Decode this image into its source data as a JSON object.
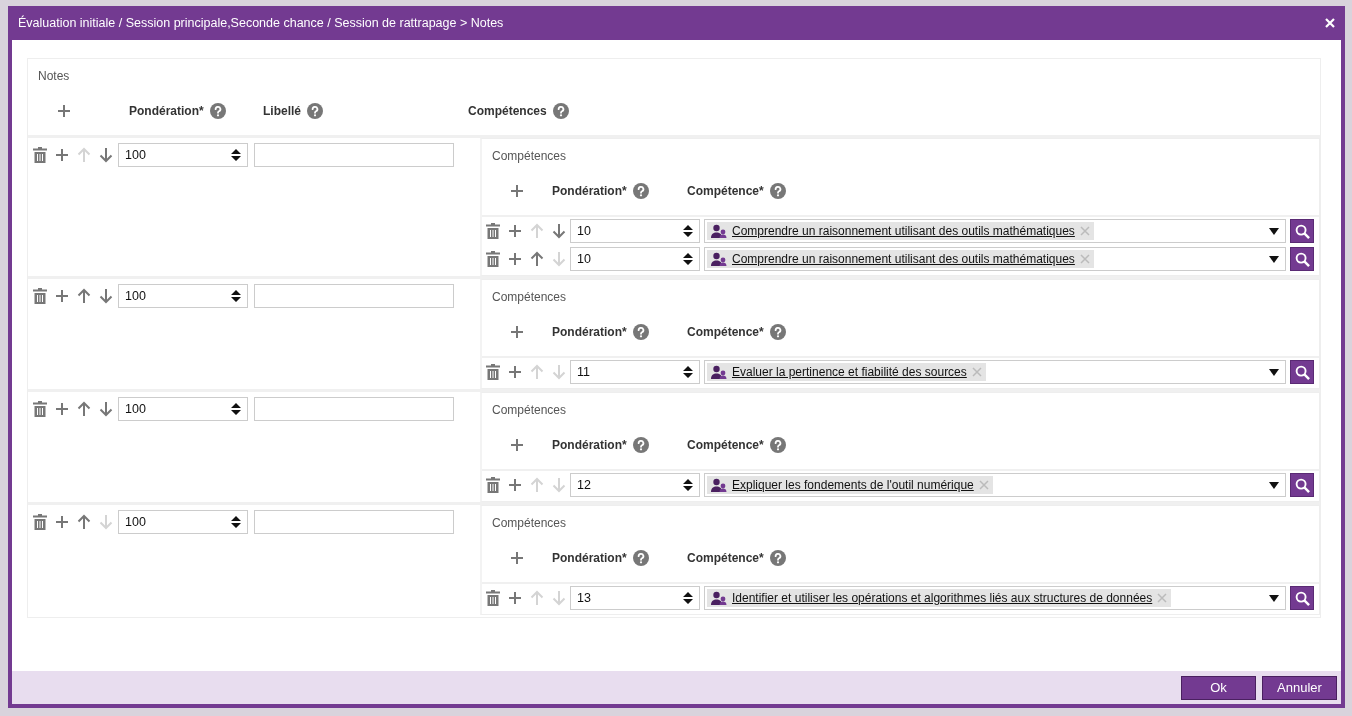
{
  "dialog": {
    "title": "Évaluation initiale / Session principale,Seconde chance / Session de rattrapage > Notes"
  },
  "notes": {
    "section_label": "Notes",
    "columns": [
      "Pondération*",
      "Libellé",
      "Compétences"
    ],
    "rows": [
      {
        "weight": "100",
        "label": "",
        "up_disabled": true,
        "down_disabled": false,
        "competences": {
          "section_label": "Compétences",
          "columns": [
            "Pondération*",
            "Compétence*"
          ],
          "rows": [
            {
              "weight": "10",
              "competence": "Comprendre un raisonnement utilisant des outils mathématiques",
              "up_disabled": true,
              "down_disabled": false
            },
            {
              "weight": "10",
              "competence": "Comprendre un raisonnement utilisant des outils mathématiques",
              "up_disabled": false,
              "down_disabled": true
            }
          ]
        }
      },
      {
        "weight": "100",
        "label": "",
        "up_disabled": false,
        "down_disabled": false,
        "competences": {
          "section_label": "Compétences",
          "columns": [
            "Pondération*",
            "Compétence*"
          ],
          "rows": [
            {
              "weight": "11",
              "competence": "Evaluer la pertinence et fiabilité des sources",
              "up_disabled": true,
              "down_disabled": true
            }
          ]
        }
      },
      {
        "weight": "100",
        "label": "",
        "up_disabled": false,
        "down_disabled": false,
        "competences": {
          "section_label": "Compétences",
          "columns": [
            "Pondération*",
            "Compétence*"
          ],
          "rows": [
            {
              "weight": "12",
              "competence": "Expliquer les fondements de l'outil numérique",
              "up_disabled": true,
              "down_disabled": true
            }
          ]
        }
      },
      {
        "weight": "100",
        "label": "",
        "up_disabled": false,
        "down_disabled": true,
        "competences": {
          "section_label": "Compétences",
          "columns": [
            "Pondération*",
            "Compétence*"
          ],
          "rows": [
            {
              "weight": "13",
              "competence": "Identifier et utiliser les opérations et algorithmes liés aux structures de données",
              "up_disabled": true,
              "down_disabled": true
            }
          ]
        }
      }
    ]
  },
  "buttons": [
    "Ok",
    "Annuler"
  ]
}
